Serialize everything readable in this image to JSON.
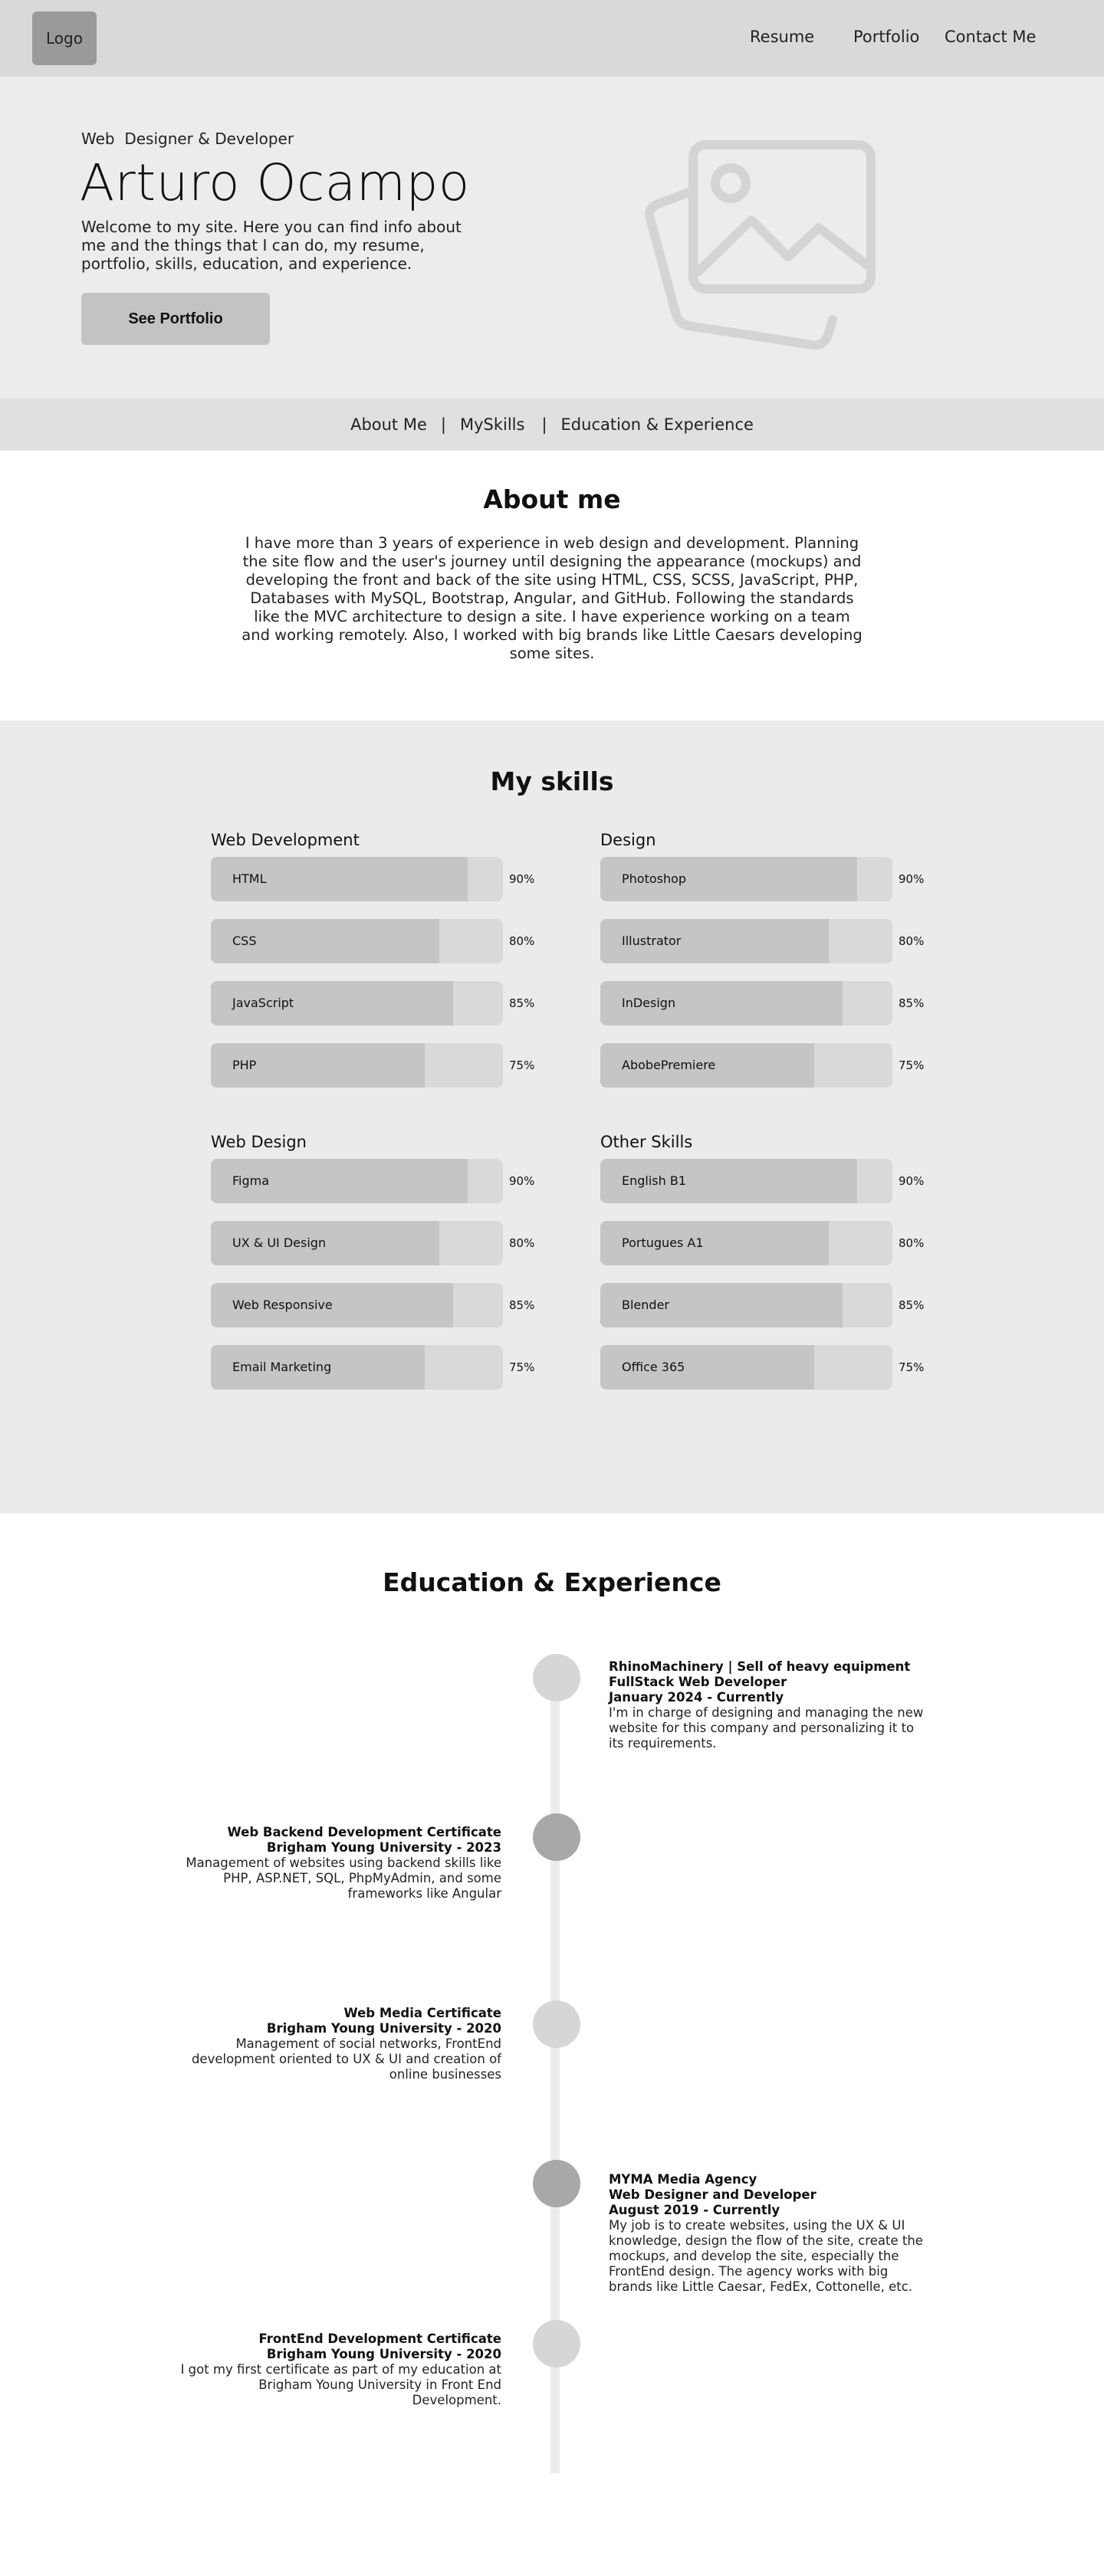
{
  "header": {
    "logo": "Logo",
    "nav": [
      "Resume",
      "Portfolio",
      "Contact Me"
    ]
  },
  "hero": {
    "kicker": "Web  Designer & Developer",
    "name": "Arturo Ocampo",
    "description": "Welcome to my site. Here you can find info about me and the things that I can do, my resume, portfolio, skills, education, and experience.",
    "button": "See Portfolio",
    "image_icon": "image-placeholder-icon"
  },
  "section_nav": {
    "about": "About Me",
    "skills": "MySkills",
    "education": "Education & Experience",
    "separator": "|"
  },
  "about": {
    "title": "About me",
    "text": "I have more than 3 years of experience in web design and development. Planning the site flow and the user's journey until designing the appearance (mockups) and developing the front and back of the site using HTML, CSS, SCSS, JavaScript, PHP, Databases with MySQL, Bootstrap, Angular, and GitHub. Following the standards like the MVC architecture to design a site. I have experience working on a team and working remotely. Also, I worked with big brands like Little Caesars developing some sites."
  },
  "skills": {
    "title": "My skills",
    "groups": [
      {
        "title": "Web Development",
        "items": [
          {
            "name": "HTML",
            "percent": 90,
            "label": "90%"
          },
          {
            "name": "CSS",
            "percent": 80,
            "label": "80%"
          },
          {
            "name": "JavaScript",
            "percent": 85,
            "label": "85%"
          },
          {
            "name": "PHP",
            "percent": 75,
            "label": "75%"
          }
        ]
      },
      {
        "title": "Design",
        "items": [
          {
            "name": "Photoshop",
            "percent": 90,
            "label": "90%"
          },
          {
            "name": "Illustrator",
            "percent": 80,
            "label": "80%"
          },
          {
            "name": "InDesign",
            "percent": 85,
            "label": "85%"
          },
          {
            "name": "AbobePremiere",
            "percent": 75,
            "label": "75%"
          }
        ]
      },
      {
        "title": "Web Design",
        "items": [
          {
            "name": "Figma",
            "percent": 90,
            "label": "90%"
          },
          {
            "name": "UX & UI Design",
            "percent": 80,
            "label": "80%"
          },
          {
            "name": "Web Responsive",
            "percent": 85,
            "label": "85%"
          },
          {
            "name": "Email Marketing",
            "percent": 75,
            "label": "75%"
          }
        ]
      },
      {
        "title": "Other Skills",
        "items": [
          {
            "name": "English B1",
            "percent": 90,
            "label": "90%"
          },
          {
            "name": "Portugues A1",
            "percent": 80,
            "label": "80%"
          },
          {
            "name": "Blender",
            "percent": 85,
            "label": "85%"
          },
          {
            "name": "Office 365",
            "percent": 75,
            "label": "75%"
          }
        ]
      }
    ]
  },
  "education": {
    "title": "Education & Experience",
    "entries": [
      {
        "side": "right",
        "title": "RhinoMachinery | Sell of heavy equipment",
        "subtitle": "FullStack Web Developer",
        "date": "January 2024 - Currently",
        "description": "I'm in charge of designing and managing the new website for this company and personalizing it to its requirements."
      },
      {
        "side": "left",
        "title": "Web Backend Development Certificate",
        "subtitle": "Brigham Young University - 2023",
        "date": "",
        "description": "Management of websites using backend skills like PHP, ASP.NET, SQL, PhpMyAdmin, and some frameworks like Angular"
      },
      {
        "side": "left",
        "title": "Web Media Certificate",
        "subtitle": "Brigham Young University - 2020",
        "date": "",
        "description": "Management of social networks, FrontEnd development oriented to UX & UI and creation of online businesses"
      },
      {
        "side": "right",
        "title": "MYMA Media Agency",
        "subtitle": "Web Designer and Developer",
        "date": "August 2019 - Currently",
        "description": "My job is to create websites, using the UX & UI knowledge, design the flow of the site, create the mockups, and develop the site, especially the FrontEnd design. The agency works with big brands like Little Caesar, FedEx, Cottonelle, etc."
      },
      {
        "side": "left",
        "title": "FrontEnd Development Certificate",
        "subtitle": "Brigham Young University - 2020",
        "date": "",
        "description": "I got my first certificate as part of my education at Brigham Young University in Front End Development."
      }
    ]
  }
}
